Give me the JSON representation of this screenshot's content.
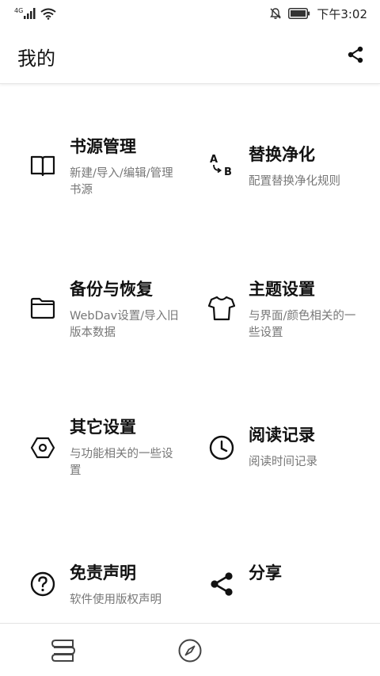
{
  "status_bar": {
    "network": "4G",
    "time": "下午3:02"
  },
  "header": {
    "title": "我的",
    "share_icon": "share-icon"
  },
  "tiles": [
    {
      "title": "书源管理",
      "desc": "新建/导入/编辑/管理书源",
      "icon": "book-icon"
    },
    {
      "title": "替换净化",
      "desc": "配置替换净化规则",
      "icon": "replace-ab-icon",
      "icon_letters": [
        "A",
        "B"
      ]
    },
    {
      "title": "备份与恢复",
      "desc": "WebDav设置/导入旧版本数据",
      "icon": "folder-icon"
    },
    {
      "title": "主题设置",
      "desc": "与界面/颜色相关的一些设置",
      "icon": "tshirt-icon"
    },
    {
      "title": "其它设置",
      "desc": "与功能相关的一些设置",
      "icon": "hexagon-nut-icon"
    },
    {
      "title": "阅读记录",
      "desc": "阅读时间记录",
      "icon": "clock-icon"
    },
    {
      "title": "免责声明",
      "desc": "软件使用版权声明",
      "icon": "help-circle-icon"
    },
    {
      "title": "分享",
      "desc": "",
      "icon": "share-icon"
    }
  ],
  "bottom_nav": [
    {
      "name": "bookshelf",
      "icon": "bookshelf-icon"
    },
    {
      "name": "discover",
      "icon": "compass-icon"
    }
  ],
  "colors": {
    "text_primary": "#111111",
    "text_secondary": "#777777",
    "icon": "#111111",
    "background": "#ffffff"
  }
}
